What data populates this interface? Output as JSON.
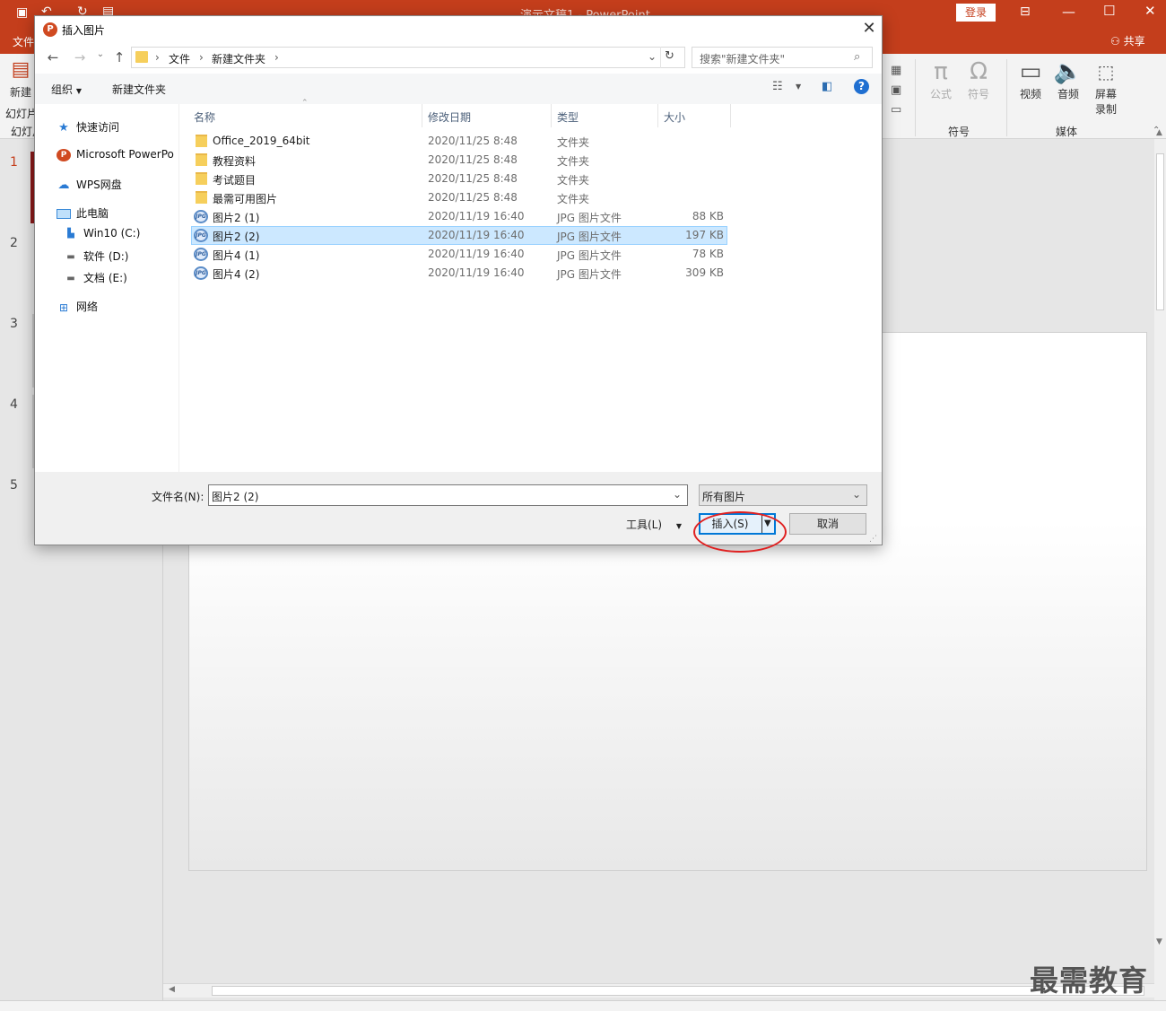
{
  "app": {
    "doc_title": "演示文稿1 - PowerPoint",
    "login_label": "登录",
    "share_label": "共享",
    "file_tab": "文件",
    "new_slide_line1": "新建",
    "new_slide_line2": "幻灯片",
    "layout_label": "幻灯片",
    "ribbon": {
      "formula": "公式",
      "symbol": "符号",
      "symbols_group": "符号",
      "video": "视频",
      "audio": "音频",
      "screen_rec_1": "屏幕",
      "screen_rec_2": "录制",
      "media_group": "媒体"
    },
    "slide_numbers": [
      "1",
      "2",
      "3",
      "4",
      "5"
    ],
    "watermark": "最需教育",
    "accent_color": "#c43e1c"
  },
  "dialog": {
    "title": "插入图片",
    "close_glyph": "✕",
    "address": {
      "crumb1": "文件",
      "crumb2": "新建文件夹"
    },
    "search_placeholder": "搜索\"新建文件夹\"",
    "toolbar": {
      "organize": "组织",
      "new_folder": "新建文件夹"
    },
    "nav": {
      "quick_access": "快速访问",
      "powerpoint": "Microsoft PowerPo",
      "wps": "WPS网盘",
      "this_pc": "此电脑",
      "drive_c": "Win10 (C:)",
      "drive_d": "软件 (D:)",
      "drive_e": "文档 (E:)",
      "network": "网络"
    },
    "columns": {
      "name": "名称",
      "date": "修改日期",
      "type": "类型",
      "size": "大小"
    },
    "files": [
      {
        "name": "Office_2019_64bit",
        "date": "2020/11/25 8:48",
        "type": "文件夹",
        "size": "",
        "kind": "folder"
      },
      {
        "name": "教程资料",
        "date": "2020/11/25 8:48",
        "type": "文件夹",
        "size": "",
        "kind": "folder"
      },
      {
        "name": "考试题目",
        "date": "2020/11/25 8:48",
        "type": "文件夹",
        "size": "",
        "kind": "folder"
      },
      {
        "name": "最需可用图片",
        "date": "2020/11/25 8:48",
        "type": "文件夹",
        "size": "",
        "kind": "folder"
      },
      {
        "name": "图片2 (1)",
        "date": "2020/11/19 16:40",
        "type": "JPG 图片文件",
        "size": "88 KB",
        "kind": "jpg"
      },
      {
        "name": "图片2 (2)",
        "date": "2020/11/19 16:40",
        "type": "JPG 图片文件",
        "size": "197 KB",
        "kind": "jpg",
        "selected": true
      },
      {
        "name": "图片4 (1)",
        "date": "2020/11/19 16:40",
        "type": "JPG 图片文件",
        "size": "78 KB",
        "kind": "jpg"
      },
      {
        "name": "图片4 (2)",
        "date": "2020/11/19 16:40",
        "type": "JPG 图片文件",
        "size": "309 KB",
        "kind": "jpg"
      }
    ],
    "jpg_badge": "JPG",
    "filename_label": "文件名(N):",
    "filename_value": "图片2 (2)",
    "filter_value": "所有图片",
    "tools_label": "工具(L)",
    "insert_label": "插入(S)",
    "cancel_label": "取消",
    "annotation_color": "#e02020"
  }
}
